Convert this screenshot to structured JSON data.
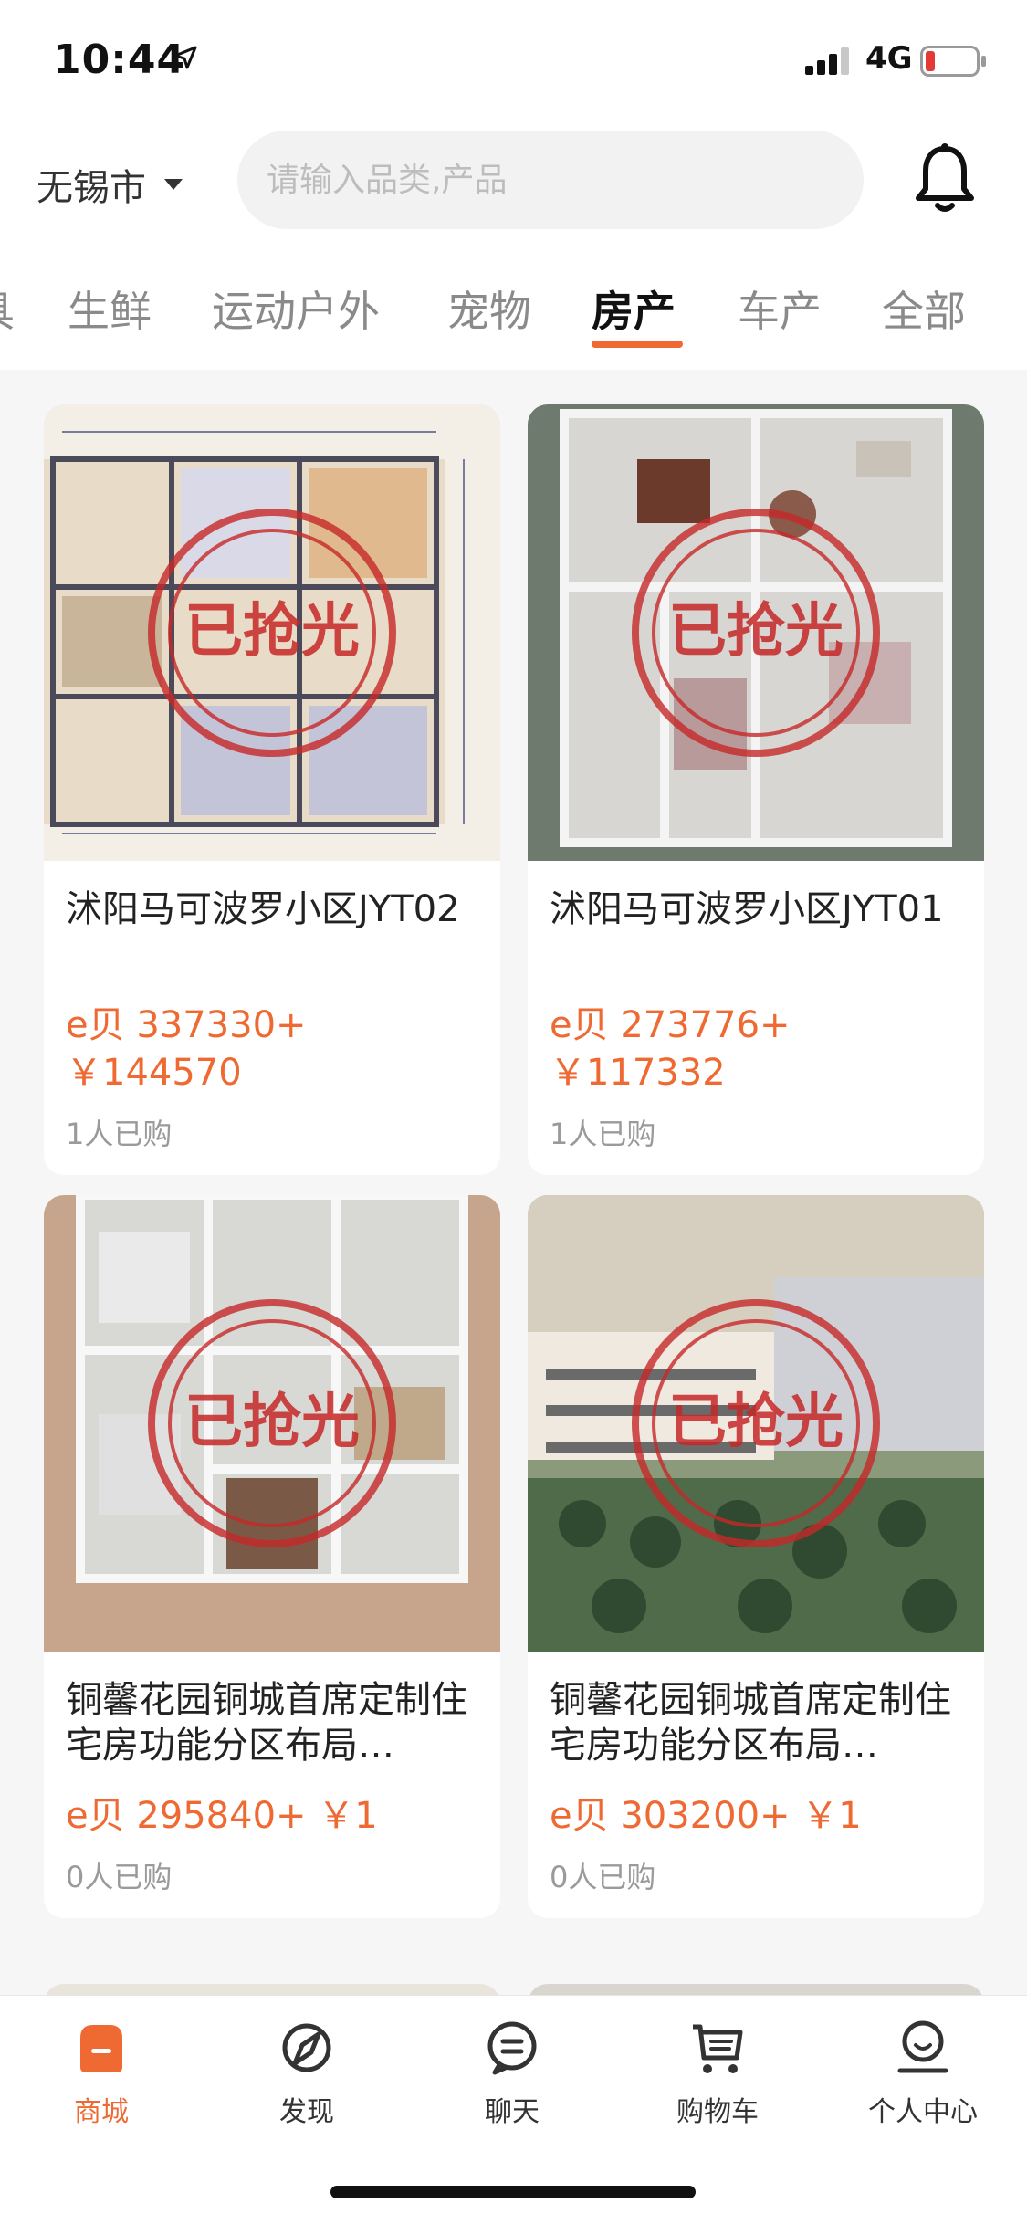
{
  "status_bar": {
    "time": "10:44",
    "network": "4G",
    "battery_color": "#e53935"
  },
  "header": {
    "city": "无锡市",
    "search_placeholder": "请输入品类,产品"
  },
  "categories": {
    "items": [
      "具",
      "生鲜",
      "运动户外",
      "宠物",
      "房产",
      "车产",
      "全部"
    ],
    "active": "房产",
    "accent_color": "#ef6a33"
  },
  "products": [
    {
      "title": "沭阳马可波罗小区JYT02",
      "price": "e贝 337330+ ￥144570",
      "sold": "1人已购",
      "image": "floor-plan",
      "stamp": "已抢光"
    },
    {
      "title": "沭阳马可波罗小区JYT01",
      "price": "e贝 273776+ ￥117332",
      "sold": "1人已购",
      "image": "apartment-model",
      "stamp": "已抢光"
    },
    {
      "title": "铜馨花园铜城首席定制住宅房功能分区布局…",
      "price": "e贝 295840+ ￥1",
      "sold": "0人已购",
      "image": "apartment-model-2",
      "stamp": "已抢光"
    },
    {
      "title": "铜馨花园铜城首席定制住宅房功能分区布局…",
      "price": "e贝 303200+ ￥1",
      "sold": "0人已购",
      "image": "estate-model",
      "stamp": "已抢光"
    }
  ],
  "tabbar": {
    "items": [
      {
        "label": "商城",
        "icon": "shop-icon"
      },
      {
        "label": "发现",
        "icon": "discover-icon"
      },
      {
        "label": "聊天",
        "icon": "chat-icon"
      },
      {
        "label": "购物车",
        "icon": "cart-icon"
      },
      {
        "label": "个人中心",
        "icon": "profile-icon"
      }
    ],
    "active": "商城"
  }
}
